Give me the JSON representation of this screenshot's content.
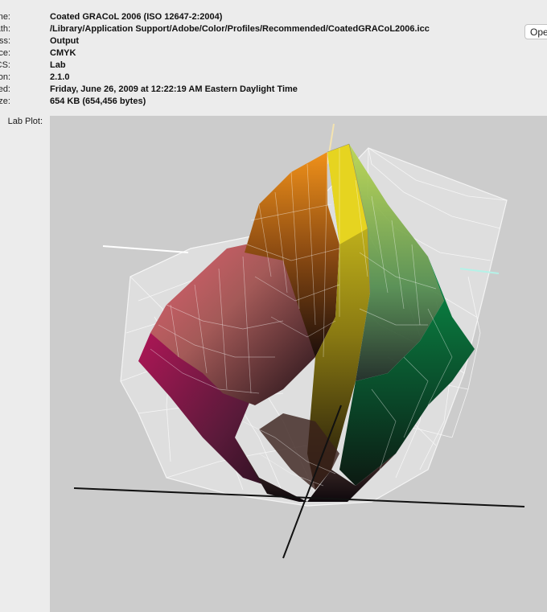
{
  "info": {
    "rows": [
      {
        "label": "Name:",
        "value": "Coated GRACoL 2006 (ISO 12647-2:2004)"
      },
      {
        "label": "Path:",
        "value": "/Library/Application Support/Adobe/Color/Profiles/Recommended/CoatedGRACoL2006.icc"
      },
      {
        "label": "Class:",
        "value": "Output"
      },
      {
        "label": "Space:",
        "value": "CMYK"
      },
      {
        "label": "PCS:",
        "value": "Lab"
      },
      {
        "label": "Version:",
        "value": "2.1.0"
      },
      {
        "label": "Created:",
        "value": "Friday, June 26, 2009 at 12:22:19 AM Eastern Daylight Time"
      },
      {
        "label": "Size:",
        "value": "654 KB (654,456 bytes)"
      }
    ]
  },
  "open_button": {
    "label": "Ope"
  },
  "plot": {
    "label": "Lab Plot:",
    "disclosure_icon": "triangle-down-icon",
    "colors": {
      "background": "#cccccc",
      "magenta": "#c4135e",
      "yellow": "#e7d81e",
      "green": "#078a45",
      "orange": "#f08a1a",
      "red": "#e8606a",
      "dark": "#1a1014",
      "axis": "#111111",
      "b_axis": "#f4e3b0",
      "a_axis": "#b5f2e8"
    }
  }
}
